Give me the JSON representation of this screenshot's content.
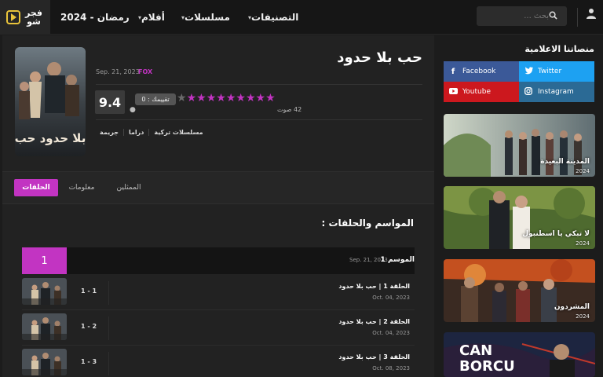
{
  "header": {
    "logo_text": "فجر شو",
    "nav": [
      {
        "label": "رمضان - 2024",
        "caret": false
      },
      {
        "label": "أفلام",
        "caret": true
      },
      {
        "label": "مسلسلات",
        "caret": true
      },
      {
        "label": "التصنيفات",
        "caret": true
      }
    ],
    "search_placeholder": "بحث ...",
    "icons": {
      "search": "search-icon",
      "user": "user-icon",
      "caret": "chevron-down-icon"
    }
  },
  "show": {
    "title": "حب بلا حدود",
    "date": "Sep. 21, 2023",
    "channel": "FOX",
    "rating": "9.4",
    "rate_label": "تقييمك : 0",
    "votes": "42 صوت",
    "stars_filled": 9,
    "stars_total": 10,
    "genres": [
      "مسلسلات تركية",
      "دراما",
      "جريمة"
    ],
    "poster_alt_text": "بلا حدود حب"
  },
  "tabs": [
    {
      "label": "الحلقات",
      "active": true
    },
    {
      "label": "معلومات",
      "active": false
    },
    {
      "label": "الممثلين",
      "active": false
    }
  ],
  "seasons_title": "المواسم والحلقات :",
  "season": {
    "number": "1",
    "label": "الموسم 1",
    "date": "Sep. 21, 2023"
  },
  "episodes": [
    {
      "num": "1 - 1",
      "title": "الحلقة 1 | حب بلا حدود",
      "date": "Oct. 04, 2023"
    },
    {
      "num": "1 - 2",
      "title": "الحلقة 2 | حب بلا حدود",
      "date": "Oct. 04, 2023"
    },
    {
      "num": "1 - 3",
      "title": "الحلقة 3 | حب بلا حدود",
      "date": "Oct. 08, 2023"
    }
  ],
  "sidebar": {
    "title": "منصاتنا الاعلامية",
    "socials": [
      {
        "label": "Facebook",
        "color": "#3b5998",
        "icon": "facebook-icon"
      },
      {
        "label": "Twitter",
        "color": "#1da1f2",
        "icon": "twitter-icon"
      },
      {
        "label": "Youtube",
        "color": "#cc181e",
        "icon": "youtube-icon"
      },
      {
        "label": "Instagram",
        "color": "#2b6a95",
        "icon": "instagram-icon"
      }
    ],
    "cards": [
      {
        "title": "المدينة البعيدة",
        "year": "2024"
      },
      {
        "title": "لا تبكي يا اسطنبول",
        "year": "2024"
      },
      {
        "title": "المشردون",
        "year": "2024"
      },
      {
        "title": "CAN BORCU",
        "year": ""
      }
    ]
  },
  "colors": {
    "accent": "#c234c2",
    "bg": "#1c1c1c",
    "panel": "#222222",
    "gold": "#e9c43b"
  }
}
